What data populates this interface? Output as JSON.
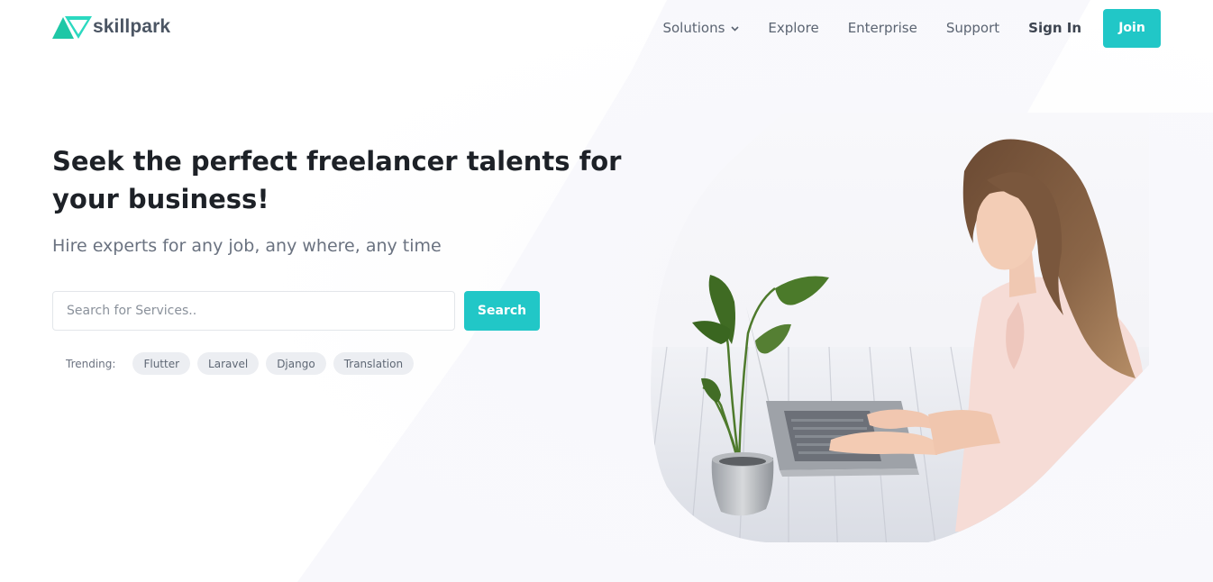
{
  "brand": {
    "name": "skillpark",
    "accent_color": "#21c7c7",
    "logo_colors": [
      "#1fc7a6",
      "#2bd9c0"
    ]
  },
  "nav": {
    "items": [
      {
        "label": "Solutions",
        "has_dropdown": true
      },
      {
        "label": "Explore"
      },
      {
        "label": "Enterprise"
      },
      {
        "label": "Support"
      }
    ],
    "signin_label": "Sign In",
    "join_label": "Join"
  },
  "hero": {
    "title_line1": "Seek the perfect freelancer talents for",
    "title_line2": "your business!",
    "subtitle": "Hire experts for any job, any where, any time"
  },
  "search": {
    "placeholder": "Search for Services..",
    "value": "",
    "button_label": "Search"
  },
  "trending": {
    "label": "Trending:",
    "tags": [
      "Flutter",
      "Laravel",
      "Django",
      "Translation"
    ]
  },
  "illustration": {
    "subject": "woman-typing-on-laptop-with-plant"
  }
}
